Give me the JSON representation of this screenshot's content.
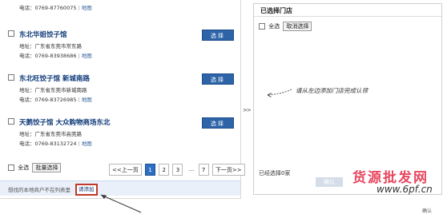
{
  "stores": [
    {
      "name": "",
      "phone": "电话：0769-87760075",
      "map_link": "地图"
    },
    {
      "name": "东北华姐饺子馆",
      "address": "地址：广东省东莞市常东路",
      "phone": "电话：0769-83938686",
      "map_link": "地图"
    },
    {
      "name": "东北旺饺子馆 新城南路",
      "address": "地址：广东省东莞市新城南路",
      "phone": "电话：0769-83726985",
      "map_link": "地图"
    },
    {
      "name": "天鹅饺子馆 大众购物商场东北",
      "address": "地址：广东省东莞市高莞路",
      "phone": "电话：0769-83132724",
      "map_link": "地图"
    }
  ],
  "select_button_label": "选择",
  "left_bulk": {
    "select_all_label": "全选",
    "bulk_select_label": "批量选择"
  },
  "pagination": {
    "prev_label": "<<上一页",
    "pages": [
      "1",
      "2",
      "3"
    ],
    "ellipsis": "...",
    "last_page": "7",
    "next_label": "下一页>>",
    "current_page": "1"
  },
  "footer": {
    "text": "想找的本地商户不在列表里",
    "add_label": "请添加"
  },
  "transfer_arrow": ">>",
  "right_panel": {
    "title": "已选择门店",
    "select_all_label": "全选",
    "cancel_select_label": "取消选择",
    "hint": "请从左边添加门店完成认领",
    "selected_count": "已经选择0家",
    "submit_label": "确认"
  },
  "watermark": {
    "text": "货源批发网",
    "url": "www.6pf.cn"
  },
  "corner_label": "确认",
  "colors": {
    "accent_blue": "#2d64a8",
    "link_blue": "#0e3a78",
    "footer_bg": "#e9f0fa",
    "highlight_red": "#c0392b",
    "watermark_pink": "#e8475f"
  }
}
